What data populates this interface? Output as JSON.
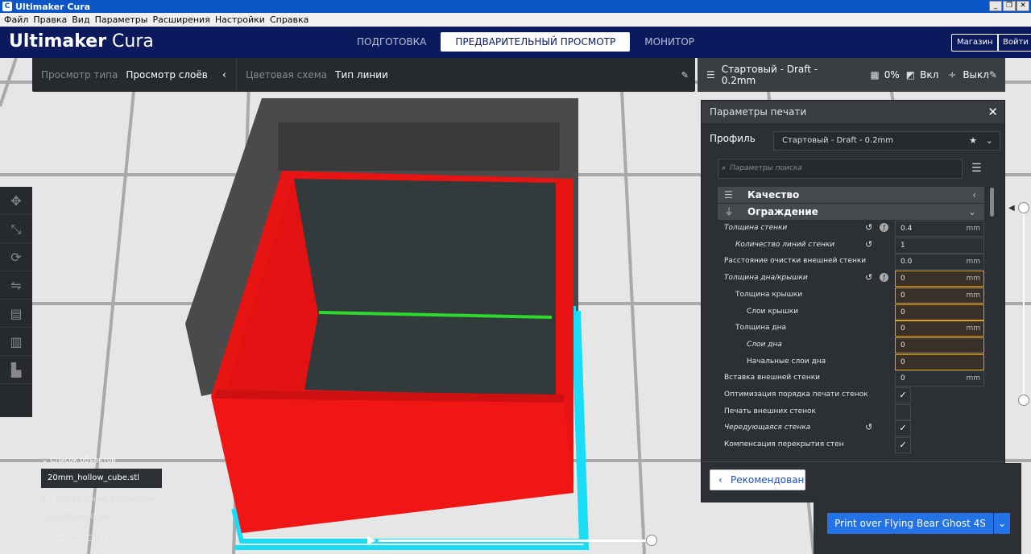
{
  "window": {
    "title": "Ultimaker Cura"
  },
  "menu": [
    "Файл",
    "Правка",
    "Вид",
    "Параметры",
    "Расширения",
    "Настройки",
    "Справка"
  ],
  "header": {
    "logo_bold": "Ultimaker",
    "logo_light": "Cura",
    "tabs": [
      {
        "label": "ПОДГОТОВКА",
        "active": false
      },
      {
        "label": "ПРЕДВАРИТЕЛЬНЫЙ ПРОСМОТР",
        "active": true
      },
      {
        "label": "МОНИТОР",
        "active": false
      }
    ],
    "marketplace": "Магазин",
    "signin": "Войти"
  },
  "viewbar": {
    "view_type_label": "Просмотр типа",
    "view_type_value": "Просмотр слоёв",
    "color_scheme_label": "Цветовая схема",
    "color_scheme_value": "Тип линии"
  },
  "printbar": {
    "profile": "Стартовый - Draft - 0.2mm",
    "infill": "0%",
    "support": "Вкл",
    "adhesion": "Выкл"
  },
  "settings_panel": {
    "title": "Параметры печати",
    "profile_label": "Профиль",
    "profile_value": "Стартовый - Draft - 0.2mm",
    "search_placeholder": "Параметры поиска",
    "categories": [
      {
        "label": "Качество",
        "expanded": false
      },
      {
        "label": "Ограждение",
        "expanded": true
      }
    ],
    "settings": [
      {
        "name": "Толщина стенки",
        "indent": 0,
        "italic": true,
        "value": "0.4",
        "unit": "mm",
        "reset": true,
        "fx": true,
        "warn": false
      },
      {
        "name": "Количество линий стенки",
        "indent": 1,
        "italic": true,
        "value": "1",
        "unit": "",
        "reset": true,
        "fx": false,
        "warn": false
      },
      {
        "name": "Расстояние очистки внешней стенки",
        "indent": 0,
        "italic": false,
        "value": "0.0",
        "unit": "mm",
        "reset": false,
        "fx": false,
        "warn": false
      },
      {
        "name": "Толщина дна/крышки",
        "indent": 0,
        "italic": true,
        "value": "0",
        "unit": "mm",
        "reset": true,
        "fx": true,
        "warn": true
      },
      {
        "name": "Толщина крышки",
        "indent": 1,
        "italic": false,
        "value": "0",
        "unit": "mm",
        "reset": false,
        "fx": false,
        "warn": true
      },
      {
        "name": "Слои крышки",
        "indent": 2,
        "italic": false,
        "value": "0",
        "unit": "",
        "reset": false,
        "fx": false,
        "warn": true
      },
      {
        "name": "Толщина дна",
        "indent": 1,
        "italic": false,
        "value": "0",
        "unit": "mm",
        "reset": false,
        "fx": false,
        "warn": true
      },
      {
        "name": "Слои дна",
        "indent": 2,
        "italic": true,
        "value": "0",
        "unit": "",
        "reset": false,
        "fx": false,
        "warn": true
      },
      {
        "name": "Начальные слои дна",
        "indent": 2,
        "italic": false,
        "value": "0",
        "unit": "",
        "reset": false,
        "fx": false,
        "warn": true
      },
      {
        "name": "Вставка внешней стенки",
        "indent": 0,
        "italic": false,
        "value": "0",
        "unit": "mm",
        "reset": false,
        "fx": false,
        "warn": false
      },
      {
        "name": "Оптимизация порядка печати стенок",
        "indent": 0,
        "italic": false,
        "checkbox": true,
        "checked": true,
        "reset": false
      },
      {
        "name": "Печать внешних стенок",
        "indent": 0,
        "italic": false,
        "checkbox": true,
        "checked": false,
        "reset": false
      },
      {
        "name": "Чередующаяся стенка",
        "indent": 0,
        "italic": true,
        "checkbox": true,
        "checked": true,
        "reset": true
      },
      {
        "name": "Компенсация перекрытия стен",
        "indent": 0,
        "italic": false,
        "checkbox": true,
        "checked": true,
        "reset": false
      }
    ],
    "recommended_button": "Рекомендован"
  },
  "objects": {
    "title": "Список объектов",
    "file": "20mm_hollow_cube.stl",
    "name": "FBG4S_20mm_hollow_cube",
    "dimensions": "20.0 x 20.0 x 20.0 мм"
  },
  "print_button": "Print over Flying Bear Ghost 4S",
  "colors": {
    "header": "#0a1a5c",
    "accent": "#2473e6",
    "wall": "#f01414",
    "skirt": "#19dcf5",
    "seam": "#2cd92c"
  }
}
